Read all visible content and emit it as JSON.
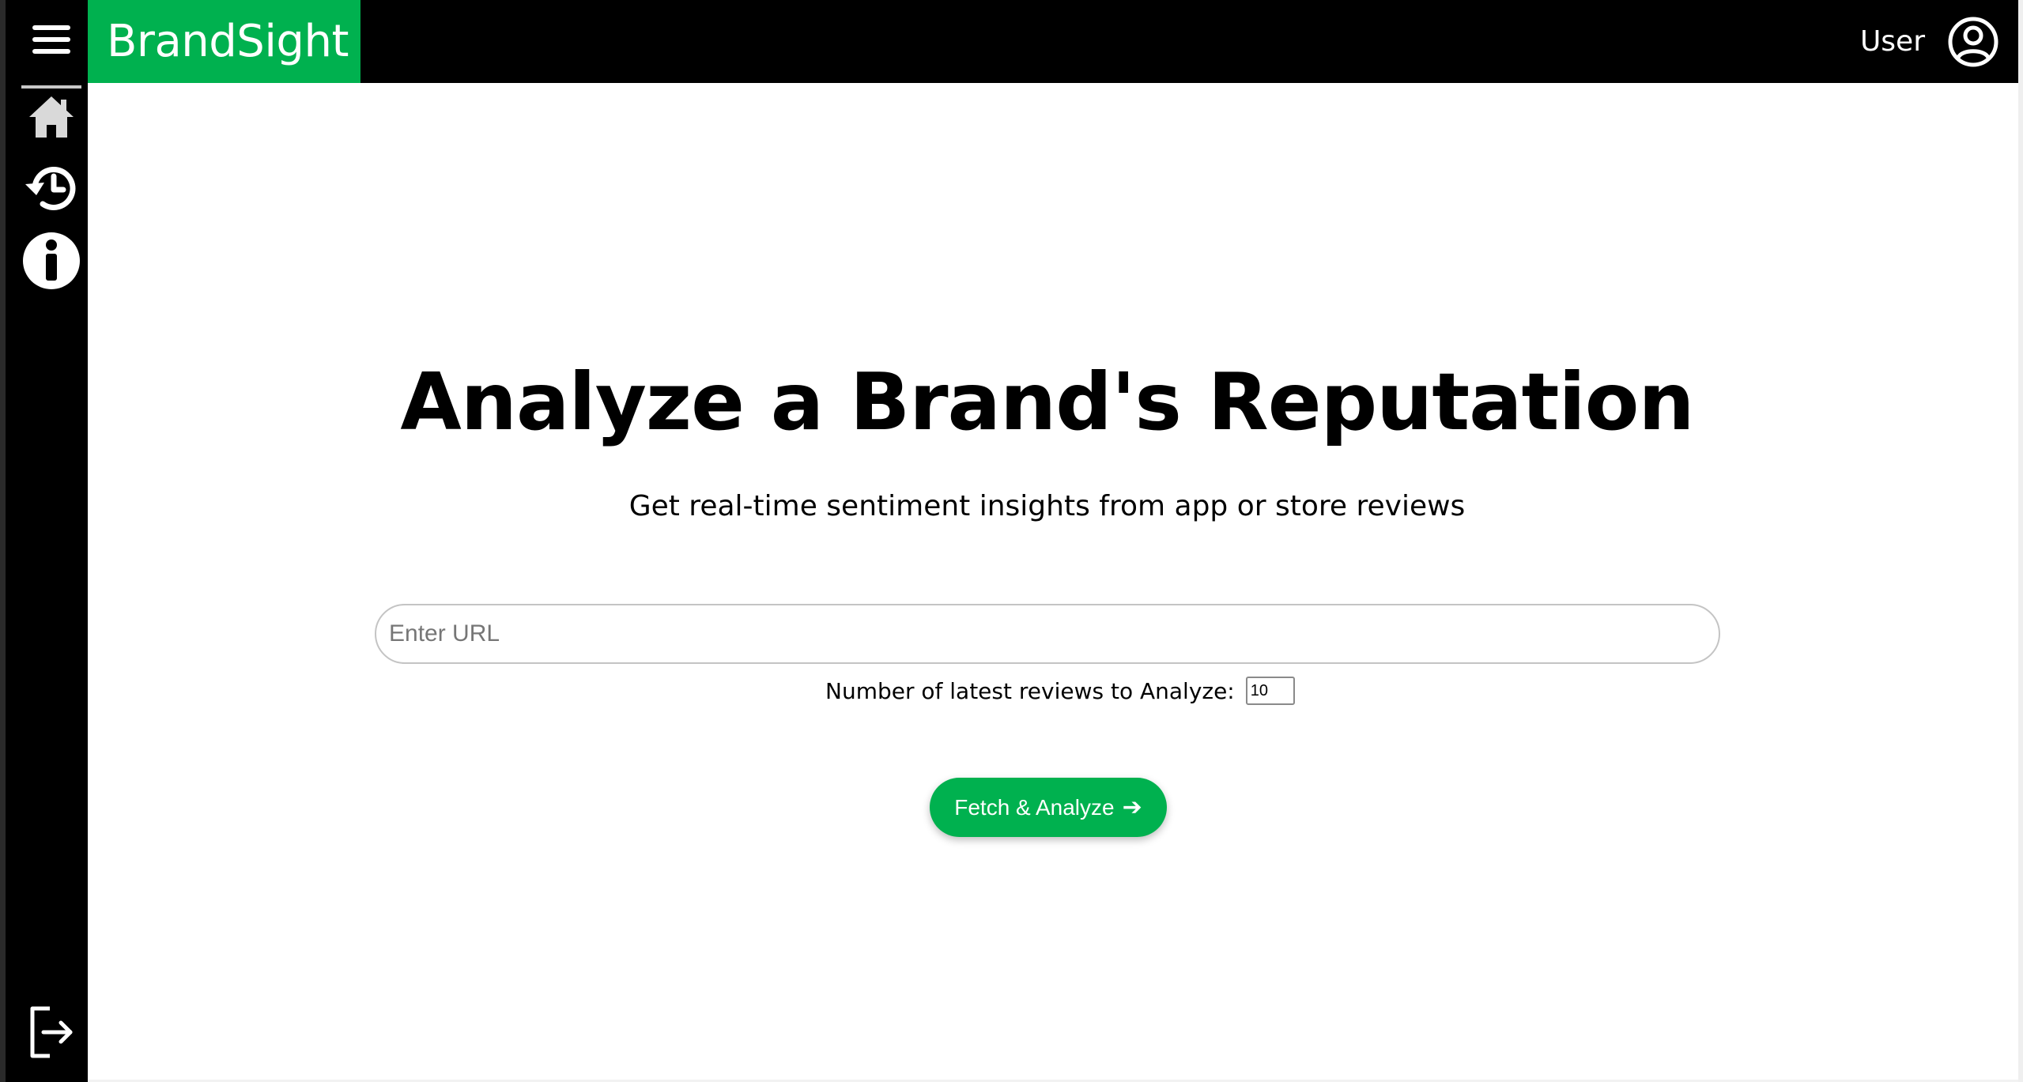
{
  "brand": {
    "name": "BrandSight",
    "color": "#00b14f"
  },
  "header": {
    "user_label": "User"
  },
  "sidebar": {
    "icons": [
      "menu-icon",
      "home-icon",
      "history-icon",
      "info-icon",
      "logout-icon"
    ]
  },
  "main": {
    "title": "Analyze a Brand's Reputation",
    "subtitle": "Get real-time sentiment insights from app or store reviews",
    "url_input": {
      "placeholder": "Enter URL",
      "value": ""
    },
    "reviews": {
      "label": "Number of latest reviews to Analyze:",
      "value": "10"
    },
    "fetch_button": {
      "label": "Fetch & Analyze",
      "arrow": "➔"
    }
  }
}
